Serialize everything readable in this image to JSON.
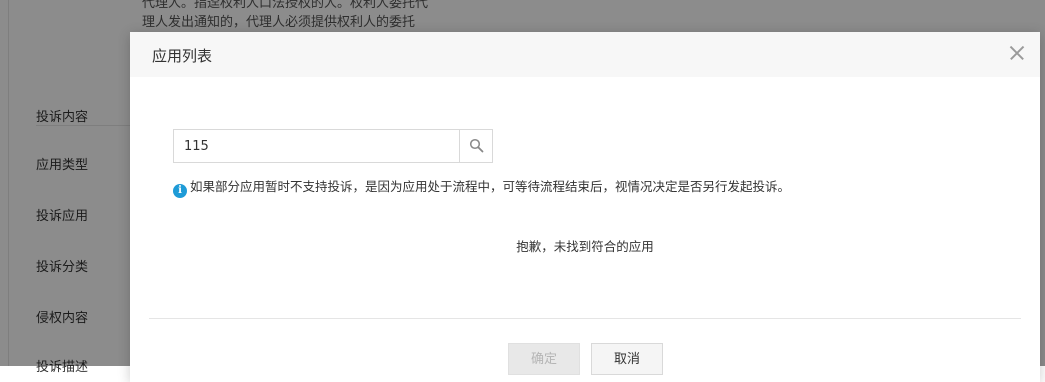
{
  "background": {
    "top_text_line1": "代理人。指迳权利人口法授权的人。权利人委托代",
    "top_text_line2": "理人发出通知的，代理人必须提供权利人的委托",
    "form_labels": [
      "投诉内容",
      "应用类型",
      "投诉应用",
      "投诉分类",
      "侵权内容",
      "投诉描述"
    ]
  },
  "modal": {
    "title": "应用列表",
    "close_icon": "close-icon",
    "search": {
      "value": "115",
      "placeholder": "",
      "icon": "search-icon"
    },
    "notice": {
      "icon": "info-icon",
      "icon_glyph": "i",
      "text": "如果部分应用暂时不支持投诉，是因为应用处于流程中，可等待流程结束后，视情况决定是否另行发起投诉。"
    },
    "empty_message": "抱歉，未找到符合的应用",
    "buttons": {
      "ok_label": "确定",
      "cancel_label": "取消"
    }
  },
  "colors": {
    "info_blue": "#1e9bd7",
    "overlay": "rgba(0,0,0,0.45)"
  }
}
